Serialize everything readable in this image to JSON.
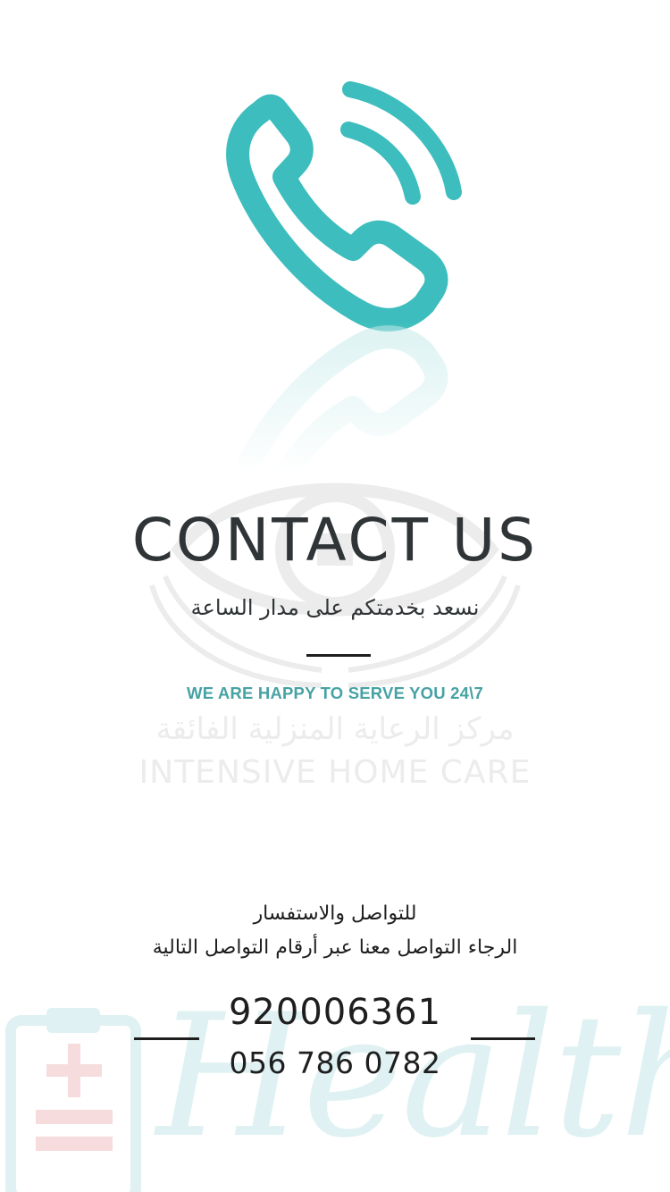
{
  "header": {
    "title": "CONTACT US",
    "subtitle_ar": "نسعد بخدمتكم على مدار الساعة",
    "tagline_en": "WE ARE HAPPY TO SERVE YOU 24\\7"
  },
  "brand": {
    "name_ar": "مركز الرعاية المنزلية الفائقة",
    "name_en": "INTENSIVE HOME CARE"
  },
  "contact": {
    "heading_ar": "للتواصل والاستفسار",
    "line_ar": "الرجاء التواصل معنا عبر أرقام التواصل التالية",
    "phone_primary": "920006361",
    "phone_secondary": "056 786 0782"
  },
  "footer": {
    "watermark_word": "Health"
  },
  "colors": {
    "accent": "#3dbdbd",
    "tagline": "#47a2a4",
    "text": "#2f3437",
    "watermark": "#ececec",
    "health_watermark": "#dff1f2",
    "clipboard_plus": "#f6dcdc"
  },
  "icons": {
    "main": "phone-handset-icon",
    "logo": "eye-hands-logo-icon",
    "footer": "clipboard-plus-icon"
  }
}
